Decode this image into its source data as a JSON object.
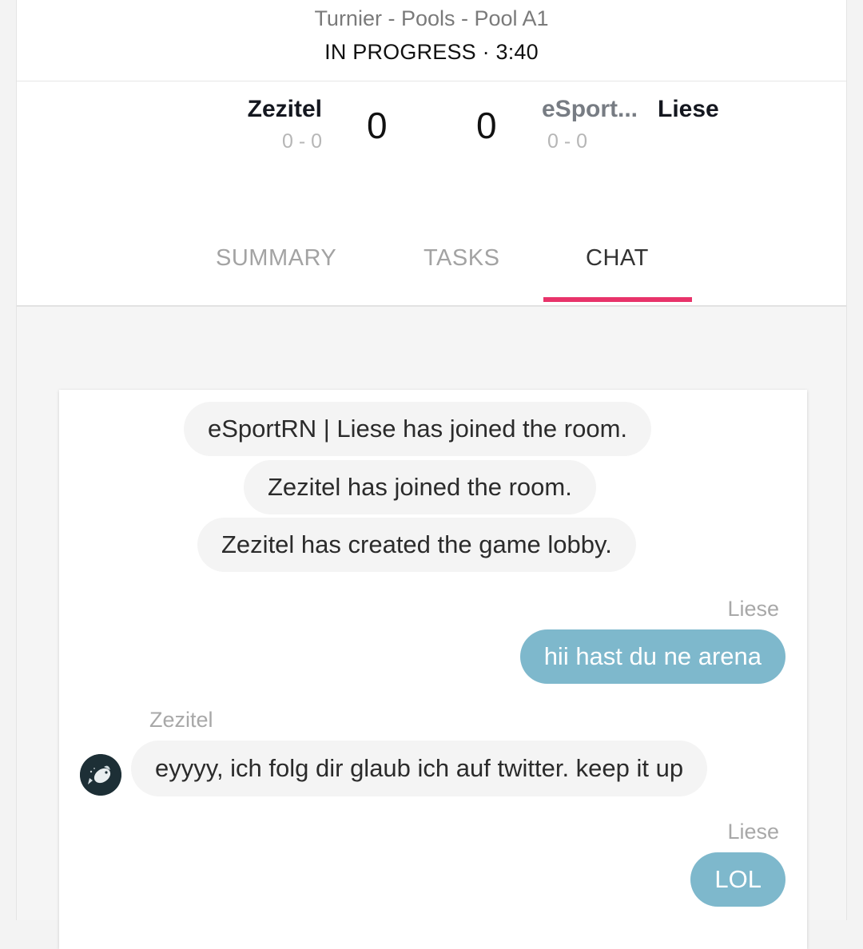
{
  "header": {
    "bracket_path": "Turnier - Pools - Pool A1",
    "status": "IN PROGRESS · 3:40"
  },
  "match": {
    "team_left": {
      "name": "Zezitel",
      "record": "0 - 0",
      "score": "0"
    },
    "team_right": {
      "tag": "eSport...",
      "name": "Liese",
      "record": "0 - 0",
      "score": "0"
    }
  },
  "tabs": [
    {
      "label": "SUMMARY",
      "active": false
    },
    {
      "label": "TASKS",
      "active": false
    },
    {
      "label": "CHAT",
      "active": true
    }
  ],
  "colors": {
    "accent": "#e8336a",
    "outgoing_bubble": "#7eb8cc",
    "system_bubble": "#f4f4f4"
  },
  "chat": {
    "system_messages": [
      "eSportRN | Liese has joined the room.",
      "Zezitel has joined the room.",
      "Zezitel has created the game lobby."
    ],
    "messages": [
      {
        "sender": "Liese",
        "text": "hii hast du ne arena",
        "direction": "outgoing"
      },
      {
        "sender": "Zezitel",
        "text": "eyyyy, ich folg dir glaub ich auf twitter. keep it up",
        "direction": "incoming",
        "avatar_icon": "fish-avatar-icon"
      },
      {
        "sender": "Liese",
        "text": "LOL",
        "direction": "outgoing"
      }
    ]
  }
}
